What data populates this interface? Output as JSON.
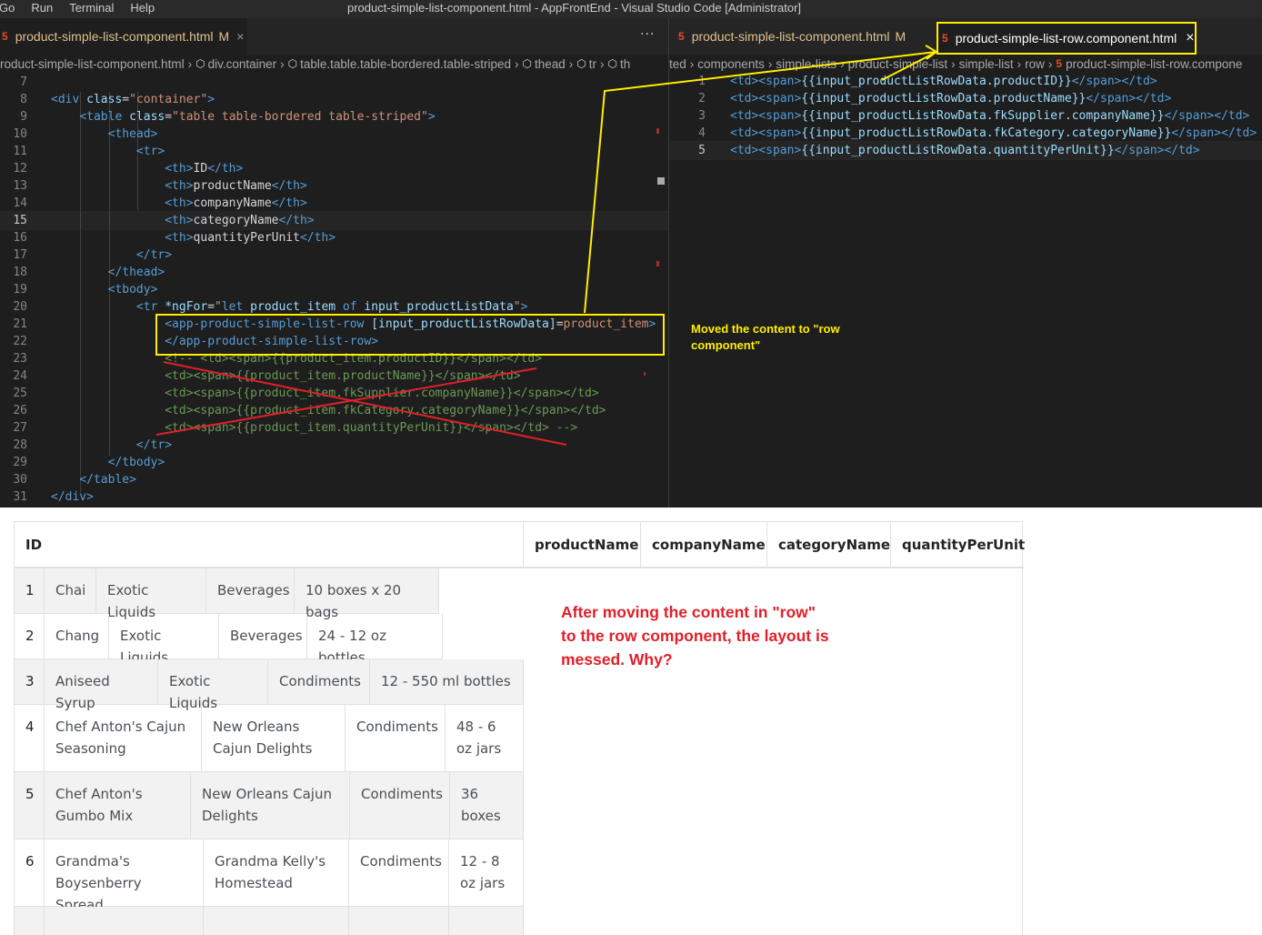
{
  "window": {
    "menu": [
      "Go",
      "Run",
      "Terminal",
      "Help"
    ],
    "title": "product-simple-list-component.html - AppFrontEnd - Visual Studio Code [Administrator]"
  },
  "left_editor": {
    "tab": {
      "label": "product-simple-list-component.html",
      "modified": "M",
      "close": "×"
    },
    "more": "···",
    "breadcrumb": [
      "roduct-simple-list-component.html",
      "div.container",
      "table.table.table-bordered.table-striped",
      "thead",
      "tr",
      "th"
    ],
    "line_numbers": [
      "7",
      "8",
      "9",
      "10",
      "11",
      "12",
      "13",
      "14",
      "15",
      "16",
      "17",
      "18",
      "19",
      "20",
      "21",
      "22",
      "23",
      "24",
      "25",
      "26",
      "27",
      "28",
      "29",
      "30",
      "31"
    ]
  },
  "right_editor": {
    "tab_inactive": {
      "label": "product-simple-list-component.html",
      "modified": "M"
    },
    "tab_active": {
      "label": "product-simple-list-row.component.html",
      "close": "×"
    },
    "breadcrumb": [
      "ted",
      "components",
      "simple-lists",
      "product-simple-list",
      "simple-list",
      "row",
      "product-simple-list-row.compone"
    ],
    "line_numbers": [
      "1",
      "2",
      "3",
      "4",
      "5"
    ],
    "lines": [
      "{{input_productListRowData.productID}}",
      "{{input_productListRowData.productName}}",
      "{{input_productListRowData.fkSupplier.companyName}}",
      "{{input_productListRowData.fkCategory.categoryName}}",
      "{{input_productListRowData.quantityPerUnit}}"
    ]
  },
  "annotations": {
    "yellow_note": "Moved the content to \"row component\"",
    "red_note": "After moving the content in \"row\" to the row component, the layout is messed. Why?",
    "colors": {
      "highlight": "#ffee00",
      "warning": "#e0202a"
    }
  },
  "table": {
    "headers": [
      "ID",
      "productName",
      "companyName",
      "categoryName",
      "quantityPerUnit"
    ],
    "rows": [
      {
        "id": "1",
        "name": "Chai",
        "company": "Exotic Liquids",
        "category": "Beverages",
        "qty": "10 boxes x 20 bags"
      },
      {
        "id": "2",
        "name": "Chang",
        "company": "Exotic Liquids",
        "category": "Beverages",
        "qty": "24 - 12 oz bottles"
      },
      {
        "id": "3",
        "name": "Aniseed Syrup",
        "company": "Exotic Liquids",
        "category": "Condiments",
        "qty": "12 - 550 ml bottles"
      },
      {
        "id": "4",
        "name": "Chef Anton's Cajun Seasoning",
        "company": "New Orleans Cajun Delights",
        "category": "Condiments",
        "qty": "48 - 6 oz jars"
      },
      {
        "id": "5",
        "name": "Chef Anton's Gumbo Mix",
        "company": "New Orleans Cajun Delights",
        "category": "Condiments",
        "qty": "36 boxes"
      },
      {
        "id": "6",
        "name": "Grandma's Boysenberry Spread",
        "company": "Grandma Kelly's Homestead",
        "category": "Condiments",
        "qty": "12 - 8 oz jars"
      }
    ]
  }
}
